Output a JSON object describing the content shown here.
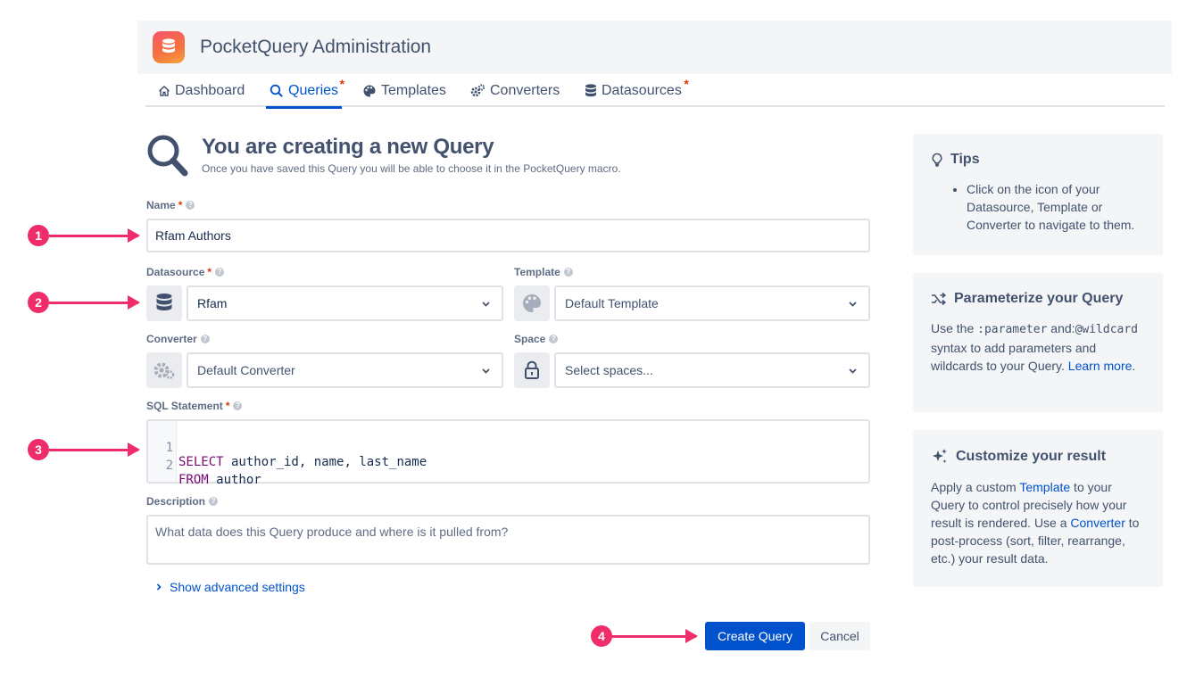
{
  "app": {
    "title": "PocketQuery Administration"
  },
  "nav": {
    "tabs": [
      {
        "label": "Dashboard",
        "icon": "home-icon"
      },
      {
        "label": "Queries",
        "icon": "search-icon",
        "active": true,
        "marker": "*"
      },
      {
        "label": "Templates",
        "icon": "palette-icon"
      },
      {
        "label": "Converters",
        "icon": "gears-icon"
      },
      {
        "label": "Datasources",
        "icon": "database-icon",
        "marker": "*"
      }
    ]
  },
  "page": {
    "title": "You are creating a new Query",
    "subtitle": "Once you have saved this Query you will be able to choose it in the PocketQuery macro."
  },
  "form": {
    "name": {
      "label": "Name",
      "required": "*",
      "value": "Rfam Authors"
    },
    "datasource": {
      "label": "Datasource",
      "required": "*",
      "value": "Rfam"
    },
    "template": {
      "label": "Template",
      "value": "Default Template"
    },
    "converter": {
      "label": "Converter",
      "value": "Default Converter"
    },
    "space": {
      "label": "Space",
      "placeholder": "Select spaces..."
    },
    "sql": {
      "label": "SQL Statement",
      "required": "*",
      "lines": [
        {
          "number": "1",
          "keyword": "SELECT",
          "rest": " author_id, name, last_name"
        },
        {
          "number": "2",
          "keyword": "FROM",
          "rest": " author"
        }
      ]
    },
    "description": {
      "label": "Description",
      "placeholder": "What data does this Query produce and where is it pulled from?"
    },
    "advanced_label": "Show advanced settings",
    "help_glyph": "?",
    "create_label": "Create Query",
    "cancel_label": "Cancel"
  },
  "panels": {
    "tips": {
      "title": "Tips",
      "items": [
        "Click on the icon of your Datasource, Template or Converter to navigate to them."
      ]
    },
    "parameterize": {
      "title": "Parameterize your Query",
      "text_1": "Use the ",
      "code_1": ":parameter",
      "text_2": " and:",
      "code_2": "@wildcard",
      "text_3": " syntax to add parameters and wildcards to your Query. ",
      "link": "Learn more",
      "text_4": "."
    },
    "customize": {
      "title": "Customize your result",
      "text_1": "Apply a custom ",
      "link_1": "Template",
      "text_2": " to your Query to control precisely how your result is rendered. Use a ",
      "link_2": "Converter",
      "text_3": " to post-process (sort, filter, rearrange, etc.) your result data."
    }
  },
  "annotations": [
    "1",
    "2",
    "3",
    "4"
  ],
  "colors": {
    "accent": "#0052cc",
    "annotation": "#ef2d6b",
    "required": "#de350b"
  }
}
